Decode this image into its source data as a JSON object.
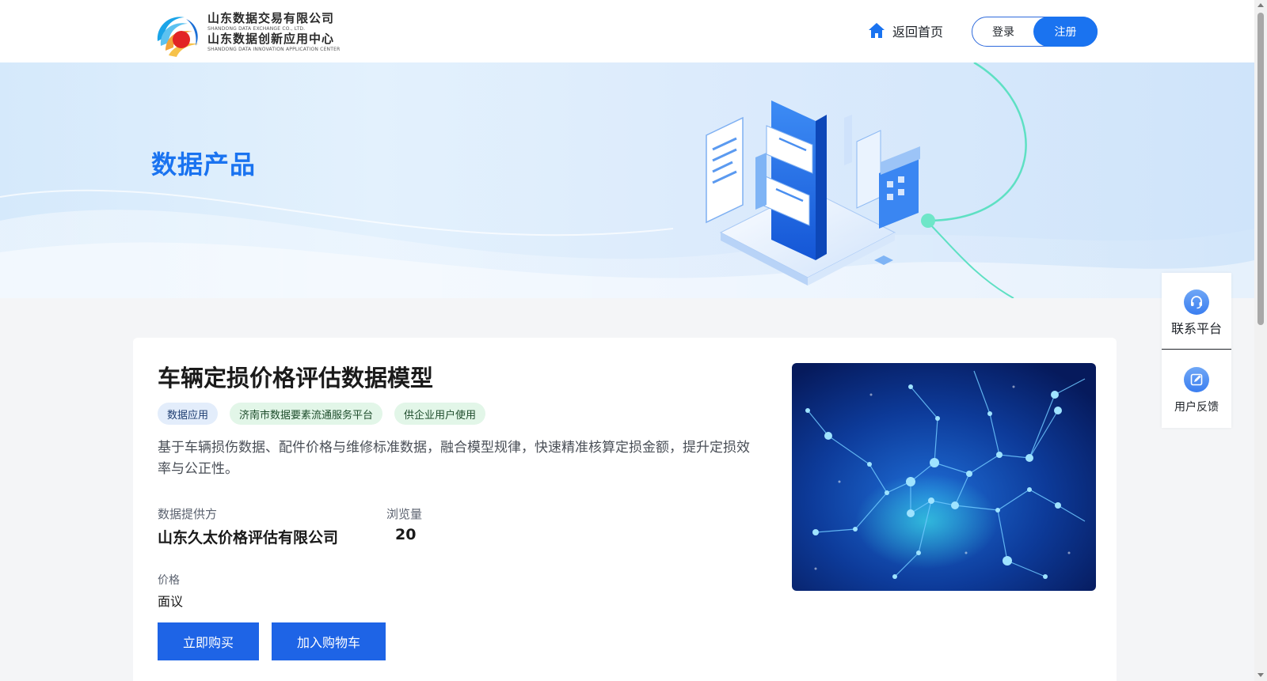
{
  "header": {
    "logo": {
      "line1_cn": "山东数据交易有限公司",
      "line1_en": "SHANDONG DATA EXCHANGE CO., LTD.",
      "line2_cn": "山东数据创新应用中心",
      "line2_en": "SHANDONG DATA INNOVATION APPLICATION CENTER"
    },
    "home_label": "返回首页",
    "login_label": "登录",
    "register_label": "注册"
  },
  "banner": {
    "title": "数据产品"
  },
  "product": {
    "title": "车辆定损价格评估数据模型",
    "tags": [
      {
        "label": "数据应用",
        "style": "blue"
      },
      {
        "label": "济南市数据要素流通服务平台",
        "style": "green"
      },
      {
        "label": "供企业用户使用",
        "style": "green"
      }
    ],
    "description": "基于车辆损伤数据、配件价格与维修标准数据，融合模型规律，快速精准核算定损金额，提升定损效率与公正性。",
    "provider_label": "数据提供方",
    "provider_value": "山东久太价格评估有限公司",
    "views_label": "浏览量",
    "views_value": "20",
    "price_label": "价格",
    "price_value": "面议",
    "buy_label": "立即购买",
    "cart_label": "加入购物车"
  },
  "side_panel": {
    "contact_label": "联系平台",
    "feedback_label": "用户反馈"
  },
  "colors": {
    "brand_blue": "#1a73f0",
    "button_blue": "#1e64e6",
    "tag_blue_bg": "#e3edfb",
    "tag_green_bg": "#e2f6e8"
  },
  "icons": {
    "home": "home-icon",
    "contact": "headset-icon",
    "feedback": "edit-icon"
  }
}
